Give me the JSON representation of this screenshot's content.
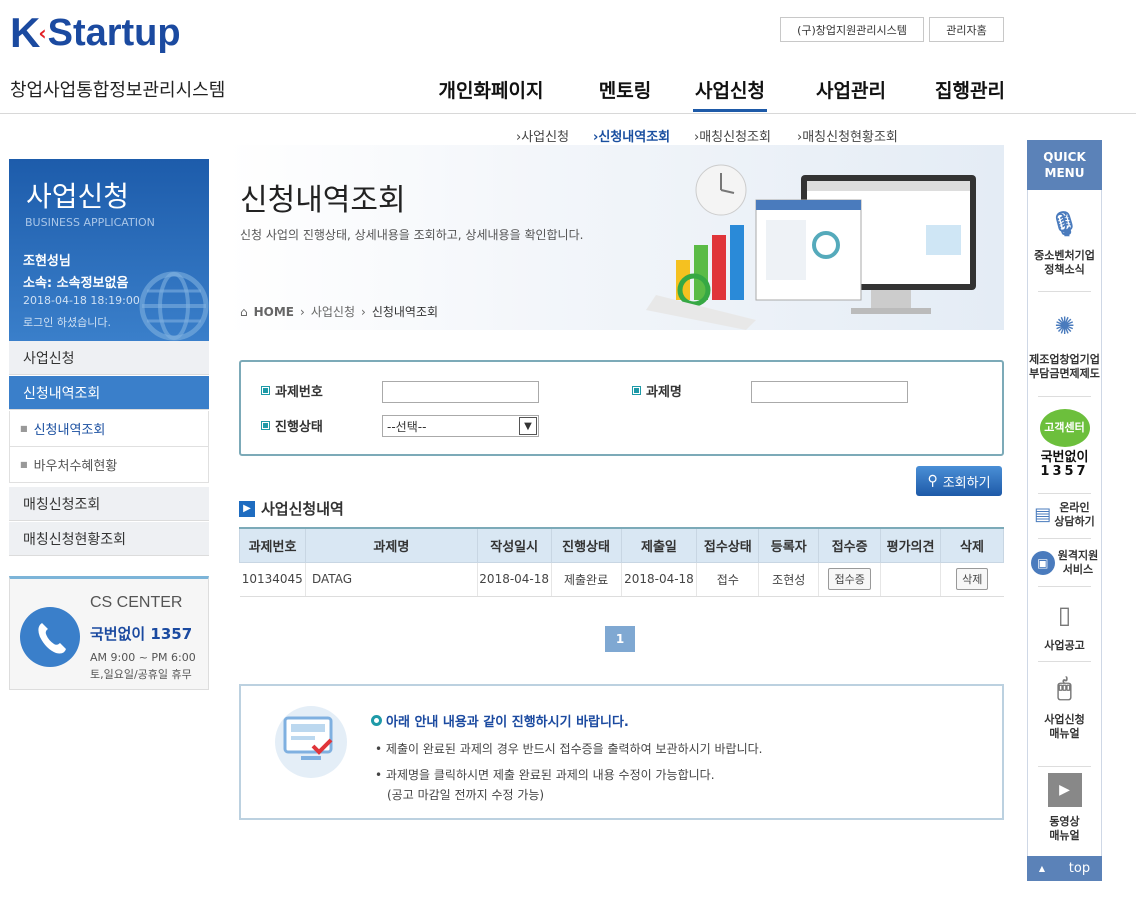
{
  "header": {
    "logo_k": "K",
    "logo_text": "Startup",
    "system_title": "창업사업통합정보관리시스템",
    "old_system_button": "(구)창업지원관리시스템",
    "admin_button": "관리자홈"
  },
  "gnb": [
    {
      "label": "개인화페이지"
    },
    {
      "label": "멘토링"
    },
    {
      "label": "사업신청"
    },
    {
      "label": "사업관리"
    },
    {
      "label": "집행관리"
    }
  ],
  "subnav": [
    {
      "label": "사업신청"
    },
    {
      "label": "신청내역조회"
    },
    {
      "label": "매칭신청조회"
    },
    {
      "label": "매칭신청현황조회"
    }
  ],
  "sidebar": {
    "title": "사업신청",
    "subtitle": "BUSINESS APPLICATION",
    "user": "조현성님",
    "affiliation": "소속: 소속정보없음",
    "login_time": "2018-04-18 18:19:00",
    "login_msg": "로그인 하셨습니다.",
    "menu": [
      {
        "label": "사업신청"
      },
      {
        "label": "신청내역조회"
      }
    ],
    "submenu": [
      {
        "label": "신청내역조회"
      },
      {
        "label": "바우처수혜현황"
      }
    ],
    "menu2": [
      {
        "label": "매칭신청조회"
      },
      {
        "label": "매칭신청현황조회"
      }
    ]
  },
  "cs": {
    "title": "CS CENTER",
    "phone": "국번없이 1357",
    "hours": "AM 9:00 ~ PM 6:00",
    "holiday": "토,일요일/공휴일 휴무"
  },
  "page": {
    "title": "신청내역조회",
    "description": "신청 사업의 진행상태, 상세내용을 조회하고, 상세내용을 확인합니다.",
    "breadcrumb_home": "HOME",
    "breadcrumb_1": "사업신청",
    "breadcrumb_2": "신청내역조회"
  },
  "search": {
    "label_number": "과제번호",
    "label_name": "과제명",
    "label_status": "진행상태",
    "status_value": "--선택--",
    "button": "조회하기"
  },
  "list": {
    "title": "사업신청내역",
    "columns": [
      "과제번호",
      "과제명",
      "작성일시",
      "진행상태",
      "제출일",
      "접수상태",
      "등록자",
      "접수증",
      "평가의견",
      "삭제"
    ],
    "rows": [
      {
        "number": "10134045",
        "name": "DATAG",
        "created": "2018-04-18",
        "status": "제출완료",
        "submitted": "2018-04-18",
        "receipt_status": "접수",
        "registrant": "조현성",
        "receipt_btn": "접수증",
        "opinion": "",
        "delete_btn": "삭제"
      }
    ]
  },
  "pagination": {
    "current": "1"
  },
  "info": {
    "title": "아래 안내 내용과 같이 진행하시기 바랍니다.",
    "line1": "제출이 완료된 과제의 경우 반드시 접수증을 출력하여 보관하시기 바랍니다.",
    "line2": "과제명을 클릭하시면 제출 완료된 과제의 내용 수정이 가능합니다.",
    "line3": "(공고 마감일 전까지 수정 가능)"
  },
  "quick": {
    "title1": "QUICK",
    "title2": "MENU",
    "items": [
      {
        "l1": "중소벤처기업",
        "l2": "정책소식"
      },
      {
        "l1": "제조업창업기업",
        "l2": "부담금면제제도"
      },
      {
        "l1": "국번없이",
        "l2": "1357",
        "badge": "고객센터"
      },
      {
        "l1": "온라인",
        "l2": "상담하기"
      },
      {
        "l1": "원격지원",
        "l2": "서비스"
      },
      {
        "l1": "사업공고",
        "l2": ""
      },
      {
        "l1": "사업신청",
        "l2": "매뉴얼"
      },
      {
        "l1": "동영상",
        "l2": "매뉴얼"
      }
    ],
    "top": "top"
  },
  "colors": {
    "brand_blue": "#1b4aa0",
    "accent_red": "#e21f26",
    "nav_active": "#3a7fca"
  }
}
